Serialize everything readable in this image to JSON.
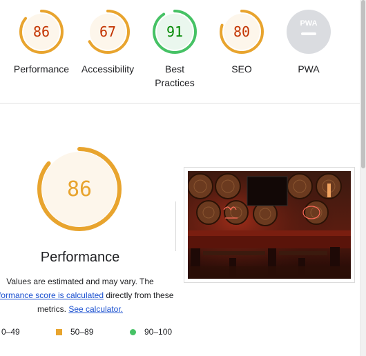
{
  "colors": {
    "average": "#e8a42e",
    "average_bg": "#fdf6eb",
    "average_text": "#c33300",
    "pass": "#46c265",
    "pass_bg": "#eaf7ee",
    "pass_text": "#008800",
    "pwa_bg": "#dadce0",
    "fail": "#eb0f00",
    "link": "#1a50d0"
  },
  "gauges": [
    {
      "id": "performance",
      "score": 86,
      "label": "Performance",
      "rating": "average"
    },
    {
      "id": "accessibility",
      "score": 67,
      "label": "Accessibility",
      "rating": "average"
    },
    {
      "id": "best-practices",
      "score": 91,
      "label": "Best Practices",
      "rating": "pass"
    },
    {
      "id": "seo",
      "score": 80,
      "label": "SEO",
      "rating": "average"
    },
    {
      "id": "pwa",
      "label": "PWA",
      "badge": "PWA",
      "rating": "pwa"
    }
  ],
  "performance": {
    "score": 86,
    "title": "Performance",
    "desc_line1": "Values are estimated and may vary. The",
    "desc_link1": "performance score is calculated",
    "desc_line2_rest": " directly from these",
    "desc_line3_pre": "metrics. ",
    "desc_link2": "See calculator."
  },
  "legend": [
    {
      "shape": "triangle-icon",
      "range": "0–49"
    },
    {
      "shape": "square-icon",
      "range": "50–89"
    },
    {
      "shape": "circle-icon",
      "range": "90–100"
    }
  ]
}
